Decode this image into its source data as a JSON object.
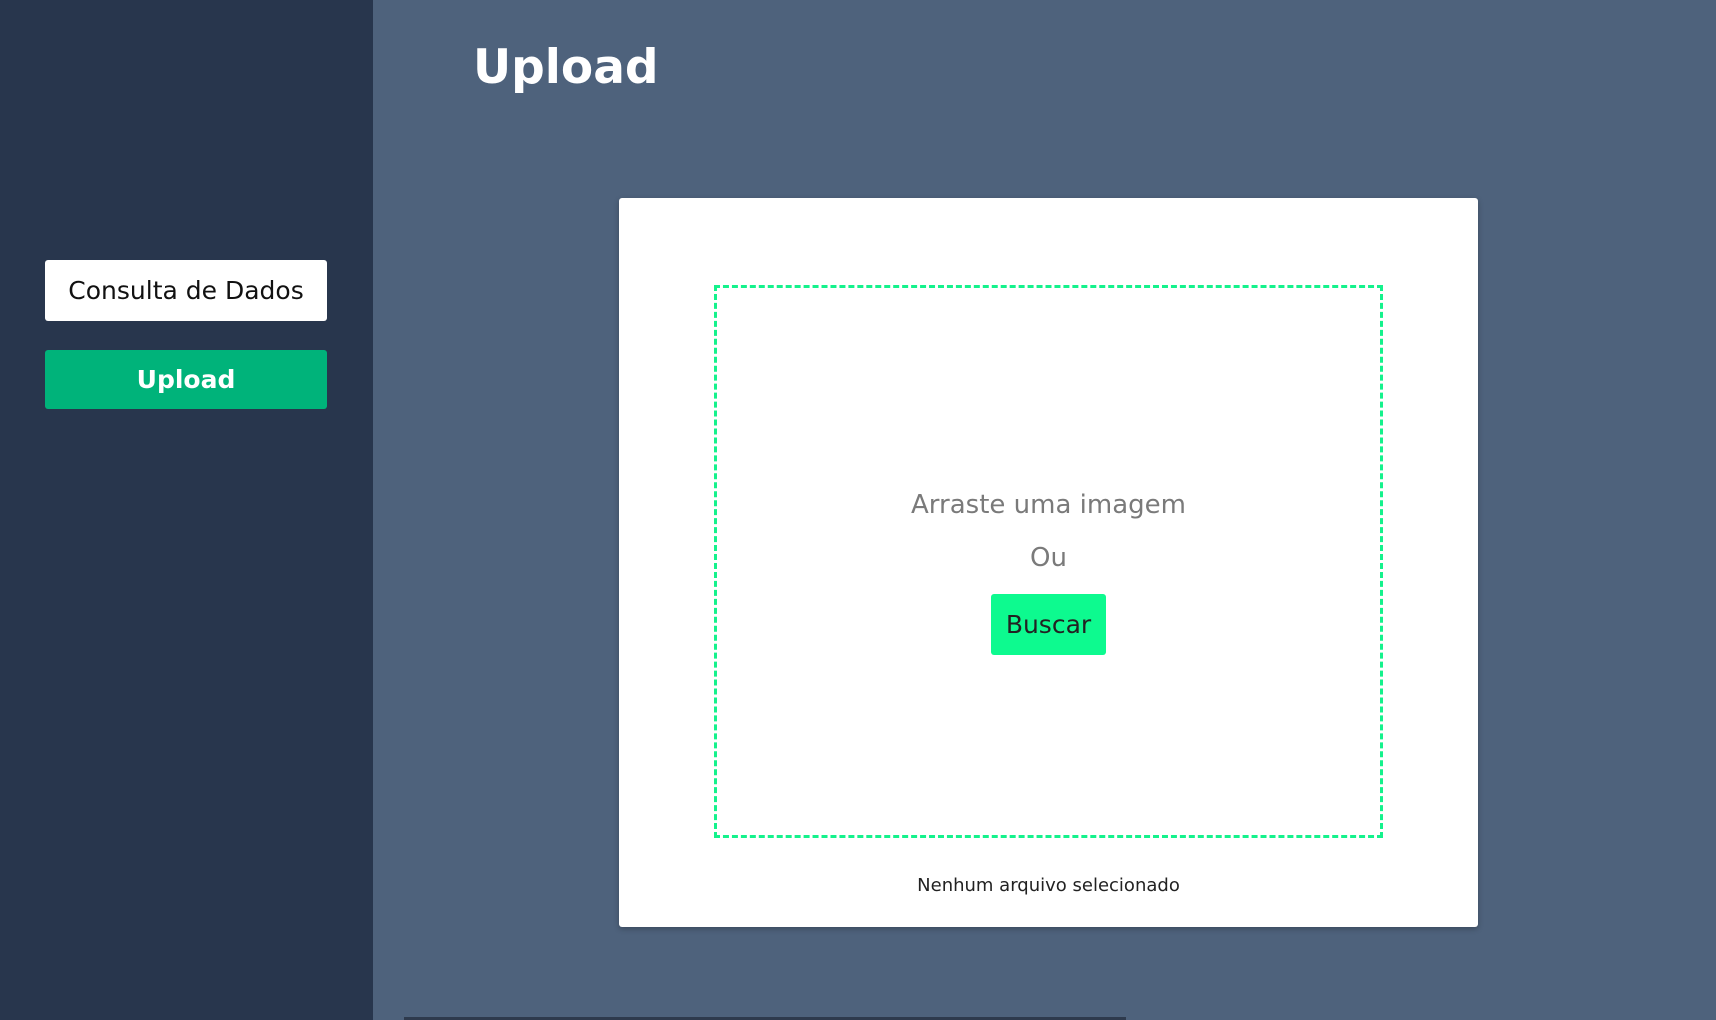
{
  "sidebar": {
    "items": [
      {
        "label": "Consulta de Dados",
        "active": false
      },
      {
        "label": "Upload",
        "active": true
      }
    ]
  },
  "header": {
    "title": "Upload"
  },
  "uploader": {
    "drag_text": "Arraste uma imagem",
    "or_text": "Ou",
    "browse_label": "Buscar",
    "file_status": "Nenhum arquivo selecionado"
  },
  "colors": {
    "sidebar_bg": "#28364d",
    "main_bg": "#4e627c",
    "active_nav": "#00b37a",
    "dropzone_border": "#14f28c",
    "browse_button": "#0dfa8f"
  }
}
